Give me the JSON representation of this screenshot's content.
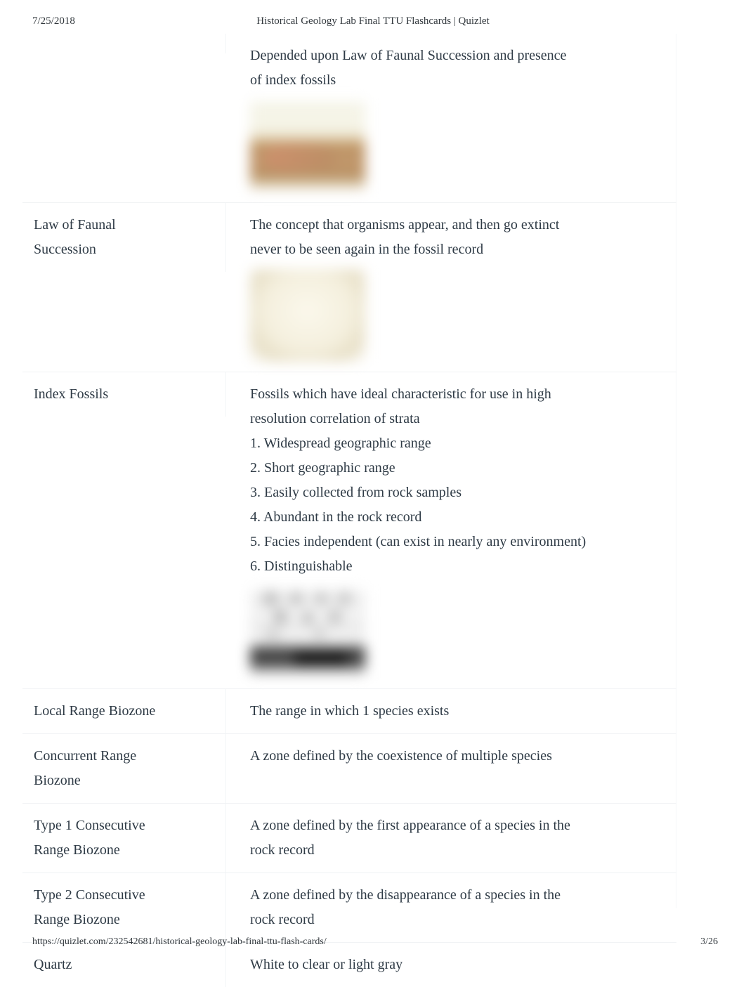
{
  "header": {
    "date": "7/25/2018",
    "title": "Historical Geology Lab Final TTU Flashcards | Quizlet"
  },
  "footer": {
    "url": "https://quizlet.com/232542681/historical-geology-lab-final-ttu-flash-cards/",
    "page": "3/26"
  },
  "cards": [
    {
      "term": "",
      "definition_lines": [
        "Depended upon Law of Faunal Succession and presence",
        "of index fossils"
      ],
      "image": "sedimentary-rock-layers-photo"
    },
    {
      "term_lines": [
        "Law of Faunal",
        "Succession"
      ],
      "term": "Law of Faunal Succession",
      "definition_lines": [
        "The concept that organisms appear, and then go extinct",
        "never to be seen again in the fossil record"
      ],
      "image": "fossil-specimen-photo"
    },
    {
      "term": "Index Fossils",
      "definition_lines": [
        "Fossils which have ideal characteristic for use in high",
        "resolution correlation of strata"
      ],
      "definition_list": [
        "1. Widespread geographic range",
        "2. Short geographic range",
        "3. Easily collected from rock samples",
        "4. Abundant in the rock record",
        "5. Facies independent (can exist in nearly any environment)",
        "6. Distinguishable"
      ],
      "image": "index-fossil-chart-photo"
    },
    {
      "term": "Local Range Biozone",
      "definition_lines": [
        "The range in which 1 species exists"
      ],
      "image": null
    },
    {
      "term_lines": [
        "Concurrent Range",
        "Biozone"
      ],
      "term": "Concurrent Range Biozone",
      "definition_lines": [
        "A zone defined by the coexistence of multiple species"
      ],
      "image": null
    },
    {
      "term_lines": [
        "Type 1 Consecutive",
        "Range Biozone"
      ],
      "term": "Type 1 Consecutive Range Biozone",
      "definition_lines": [
        "A zone defined by the first appearance of a species in the",
        "rock record"
      ],
      "image": null
    },
    {
      "term_lines": [
        "Type 2 Consecutive",
        "Range Biozone"
      ],
      "term": "Type 2 Consecutive Range Biozone",
      "definition_lines": [
        "A zone defined by the disappearance of a species in the",
        "rock record"
      ],
      "image": null
    },
    {
      "term": "Quartz",
      "definition_lines": [
        "White to clear or light gray"
      ],
      "image": null
    }
  ]
}
